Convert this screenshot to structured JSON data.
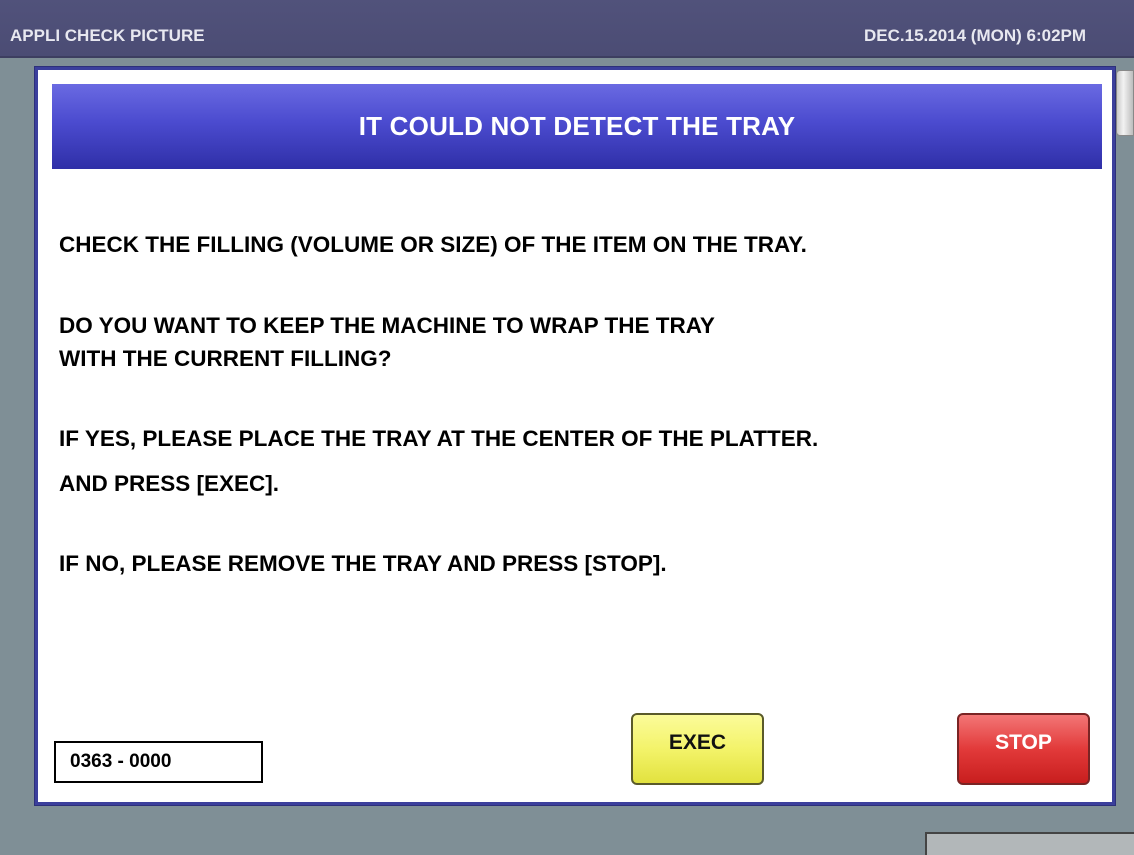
{
  "topbar": {
    "title": "APPLI CHECK PICTURE",
    "datetime": "DEC.15.2014 (MON)   6:02PM"
  },
  "dialog": {
    "title": "IT COULD NOT DETECT THE TRAY",
    "lines": [
      "CHECK THE FILLING (VOLUME OR SIZE) OF THE ITEM ON THE TRAY.",
      "DO YOU WANT TO KEEP THE MACHINE TO WRAP THE TRAY",
      "WITH THE CURRENT FILLING?",
      "IF YES, PLEASE PLACE THE TRAY AT THE CENTER OF THE PLATTER.",
      "AND PRESS [EXEC].",
      "IF NO, PLEASE REMOVE THE TRAY AND PRESS [STOP]."
    ],
    "code": "0363 - 0000",
    "exec_label": "EXEC",
    "stop_label": "STOP"
  },
  "colors": {
    "header_blue": "#4b4bcf",
    "exec_yellow": "#f3f36a",
    "stop_red": "#e23a3a",
    "topbar": "#4b4c74",
    "background": "#7f8f96"
  }
}
